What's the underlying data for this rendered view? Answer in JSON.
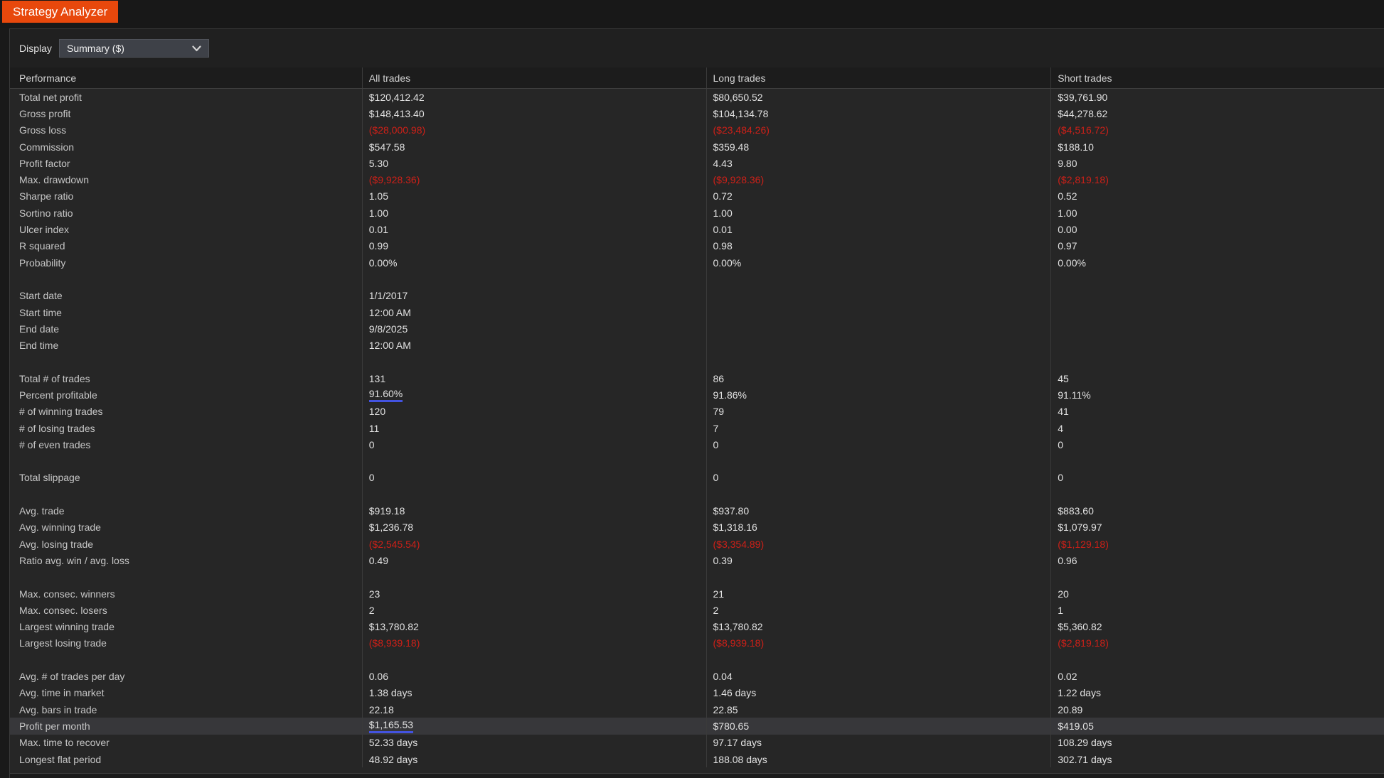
{
  "window": {
    "tab_title": "Strategy Analyzer"
  },
  "toolbar": {
    "display_label": "Display",
    "display_value": "Summary ($)"
  },
  "table": {
    "headers": [
      "Performance",
      "All trades",
      "Long trades",
      "Short trades"
    ],
    "rows": [
      {
        "label": "Total net profit",
        "all": "$120,412.42",
        "long": "$80,650.52",
        "short": "$39,761.90"
      },
      {
        "label": "Gross profit",
        "all": "$148,413.40",
        "long": "$104,134.78",
        "short": "$44,278.62"
      },
      {
        "label": "Gross loss",
        "all": "($28,000.98)",
        "long": "($23,484.26)",
        "short": "($4,516.72)"
      },
      {
        "label": "Commission",
        "all": "$547.58",
        "long": "$359.48",
        "short": "$188.10"
      },
      {
        "label": "Profit factor",
        "all": "5.30",
        "long": "4.43",
        "short": "9.80"
      },
      {
        "label": "Max. drawdown",
        "all": "($9,928.36)",
        "long": "($9,928.36)",
        "short": "($2,819.18)"
      },
      {
        "label": "Sharpe ratio",
        "all": "1.05",
        "long": "0.72",
        "short": "0.52"
      },
      {
        "label": "Sortino ratio",
        "all": "1.00",
        "long": "1.00",
        "short": "1.00"
      },
      {
        "label": "Ulcer index",
        "all": "0.01",
        "long": "0.01",
        "short": "0.00"
      },
      {
        "label": "R squared",
        "all": "0.99",
        "long": "0.98",
        "short": "0.97"
      },
      {
        "label": "Probability",
        "all": "0.00%",
        "long": "0.00%",
        "short": "0.00%"
      },
      {
        "spacer": true
      },
      {
        "label": "Start date",
        "all": "1/1/2017",
        "long": "",
        "short": ""
      },
      {
        "label": "Start time",
        "all": "12:00 AM",
        "long": "",
        "short": ""
      },
      {
        "label": "End date",
        "all": "9/8/2025",
        "long": "",
        "short": ""
      },
      {
        "label": "End time",
        "all": "12:00 AM",
        "long": "",
        "short": ""
      },
      {
        "spacer": true
      },
      {
        "label": "Total # of trades",
        "all": "131",
        "long": "86",
        "short": "45"
      },
      {
        "label": "Percent profitable",
        "all": "91.60%",
        "long": "91.86%",
        "short": "91.11%",
        "u": [
          "all"
        ]
      },
      {
        "label": "# of winning trades",
        "all": "120",
        "long": "79",
        "short": "41"
      },
      {
        "label": "# of losing trades",
        "all": "11",
        "long": "7",
        "short": "4"
      },
      {
        "label": "# of even trades",
        "all": "0",
        "long": "0",
        "short": "0"
      },
      {
        "spacer": true
      },
      {
        "label": "Total slippage",
        "all": "0",
        "long": "0",
        "short": "0"
      },
      {
        "spacer": true
      },
      {
        "label": "Avg. trade",
        "all": "$919.18",
        "long": "$937.80",
        "short": "$883.60"
      },
      {
        "label": "Avg. winning trade",
        "all": "$1,236.78",
        "long": "$1,318.16",
        "short": "$1,079.97"
      },
      {
        "label": "Avg. losing trade",
        "all": "($2,545.54)",
        "long": "($3,354.89)",
        "short": "($1,129.18)"
      },
      {
        "label": "Ratio avg. win / avg. loss",
        "all": "0.49",
        "long": "0.39",
        "short": "0.96"
      },
      {
        "spacer": true
      },
      {
        "label": "Max. consec. winners",
        "all": "23",
        "long": "21",
        "short": "20"
      },
      {
        "label": "Max. consec. losers",
        "all": "2",
        "long": "2",
        "short": "1"
      },
      {
        "label": "Largest winning trade",
        "all": "$13,780.82",
        "long": "$13,780.82",
        "short": "$5,360.82"
      },
      {
        "label": "Largest losing trade",
        "all": "($8,939.18)",
        "long": "($8,939.18)",
        "short": "($2,819.18)"
      },
      {
        "spacer": true
      },
      {
        "label": "Avg. # of trades per day",
        "all": "0.06",
        "long": "0.04",
        "short": "0.02"
      },
      {
        "label": "Avg. time in market",
        "all": "1.38 days",
        "long": "1.46 days",
        "short": "1.22 days"
      },
      {
        "label": "Avg. bars in trade",
        "all": "22.18",
        "long": "22.85",
        "short": "20.89"
      },
      {
        "label": "Profit per month",
        "all": "$1,165.53",
        "long": "$780.65",
        "short": "$419.05",
        "u": [
          "all"
        ],
        "hl": true
      },
      {
        "label": "Max. time to recover",
        "all": "52.33 days",
        "long": "97.17 days",
        "short": "108.29 days"
      },
      {
        "label": "Longest flat period",
        "all": "48.92 days",
        "long": "188.08 days",
        "short": "302.71 days"
      }
    ]
  },
  "colors": {
    "accent_orange": "#e8480c",
    "negative_red": "#cd2018",
    "underline_blue": "#4353e0",
    "body_bg": "#262626",
    "header_bg": "#1c1c1c"
  }
}
